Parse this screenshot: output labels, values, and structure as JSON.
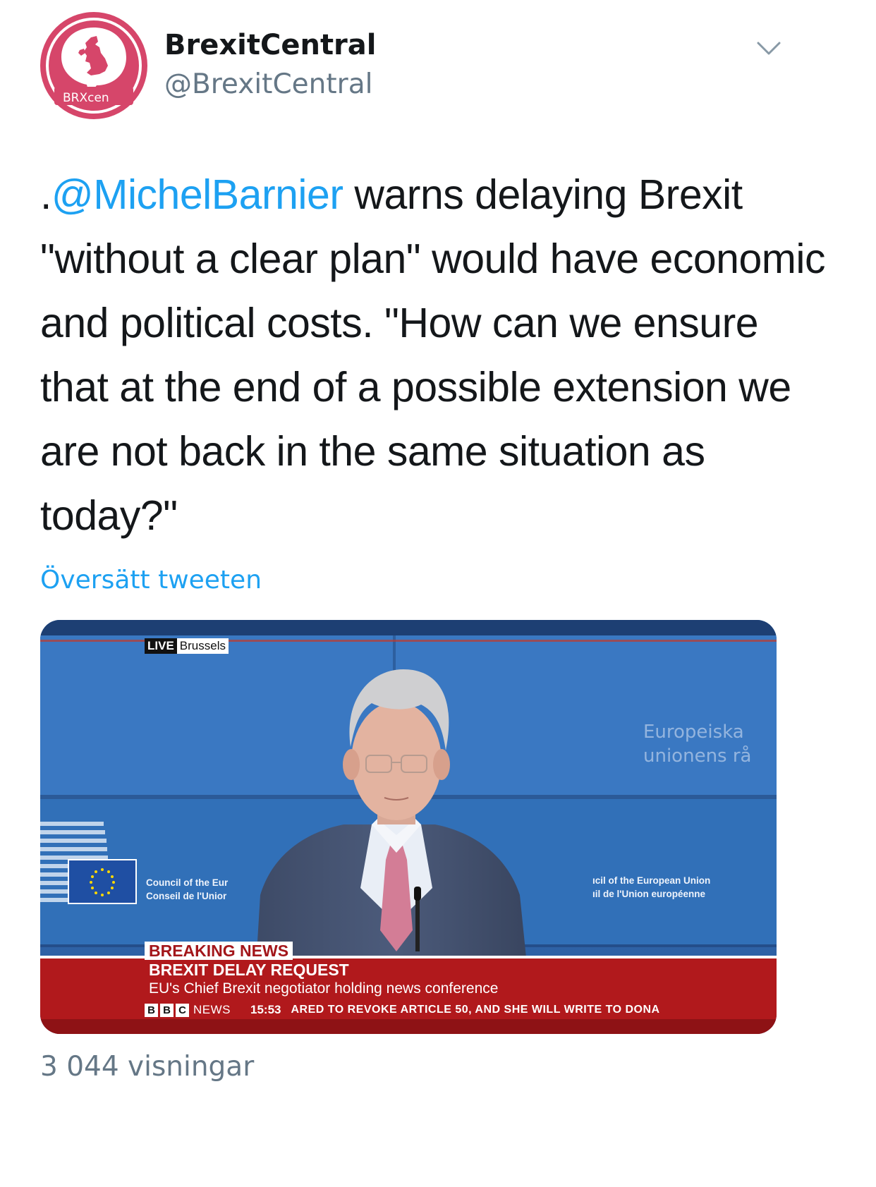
{
  "author": {
    "display_name": "BrexitCentral",
    "handle": "@BrexitCentral",
    "avatar_text": "BRXcen",
    "avatar_color": "#d6466a"
  },
  "tweet": {
    "prefix": ".",
    "mention": "@MichelBarnier",
    "body": " warns delaying Brexit \"without a clear plan\" would have economic and political costs. \"How can we ensure that at the end of a possible extension we are not back in the same situation as today?\"",
    "mention_color": "#1da1f2"
  },
  "translate_label": "Översätt tweeten",
  "media": {
    "live_label": "LIVE",
    "location": "Brussels",
    "backdrop_text_line1": "Europeiska",
    "backdrop_text_line2": "unionens rå",
    "council_left_line1": "Council of the Eur",
    "council_left_line2": "Conseil de l'Unior",
    "council_right_line1": "ıcil of the European Union",
    "council_right_line2": "ıil de l'Union européenne",
    "breaking_label": "BREAKING NEWS",
    "headline": "BREXIT DELAY REQUEST",
    "subline": "EU's Chief Brexit negotiator holding news conference",
    "bbc_letters": [
      "B",
      "B",
      "C"
    ],
    "news_word": "NEWS",
    "time": "15:53",
    "ticker_text": "ARED TO REVOKE ARTICLE 50, AND SHE WILL WRITE TO DONA",
    "bar_color": "#b1191c"
  },
  "views": "3 044 visningar",
  "icons": {
    "chevron": "chevron-down-icon",
    "uk_map": "uk-map-icon",
    "eu_flag": "eu-flag-icon"
  }
}
